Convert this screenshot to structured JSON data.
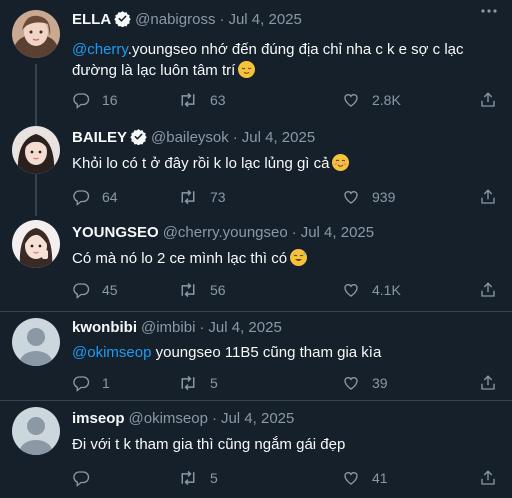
{
  "tweets": [
    {
      "name": "ELLA",
      "verified": true,
      "handle": "@nabigross",
      "date": "Jul 4, 2025",
      "mention": "@cherry",
      "text_line1": ".youngseo nhớ đến đúng địa chỉ nha c k e sợ c lạc",
      "text_line2": "đường là lạc luôn tâm trí",
      "emoji": "relieved-face",
      "replies": "16",
      "retweets": "63",
      "likes": "2.8K"
    },
    {
      "name": "BAILEY",
      "verified": true,
      "handle": "@baileysok",
      "date": "Jul 4, 2025",
      "text": "Khỏi lo có t ở đây rồi k lo lạc lủng gì cả",
      "emoji": "smiling-face",
      "replies": "64",
      "retweets": "73",
      "likes": "939"
    },
    {
      "name": "YOUNGSEO",
      "verified": false,
      "handle": "@cherry.youngseo",
      "date": "Jul 4, 2025",
      "text": "Có mà nó lo 2 ce mình lạc thì có",
      "emoji": "sweat-smile-face",
      "replies": "45",
      "retweets": "56",
      "likes": "4.1K"
    },
    {
      "name": "kwonbibi",
      "verified": false,
      "handle": "@imbibi",
      "date": "Jul 4, 2025",
      "mention": "@okimseop",
      "text": " youngseo 11B5 cũng tham gia kìa",
      "replies": "1",
      "retweets": "5",
      "likes": "39"
    },
    {
      "name": "imseop",
      "verified": false,
      "handle": "@okimseop",
      "date": "Jul 4, 2025",
      "text": "Đi với t k tham gia thì cũng ngắm gái đẹp",
      "replies": "",
      "retweets": "5",
      "likes": "41"
    }
  ],
  "separator": "·",
  "colors": {
    "background": "#15202b",
    "accent": "#1d9bf0",
    "muted": "#8b98a5",
    "divider": "#38444d"
  }
}
